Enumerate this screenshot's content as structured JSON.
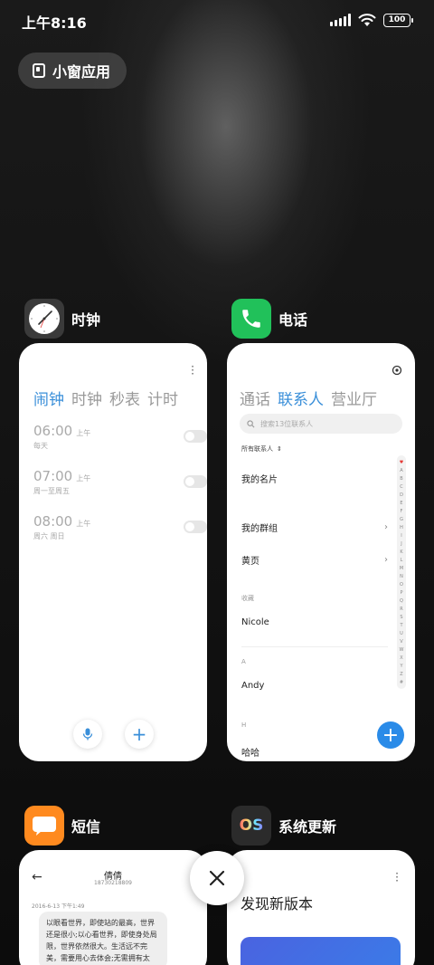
{
  "status": {
    "time": "上午8:16",
    "battery": "100"
  },
  "small_window": {
    "label": "小窗应用"
  },
  "apps": {
    "clock": {
      "name": "时钟",
      "tabs": [
        "闹钟",
        "时钟",
        "秒表",
        "计时"
      ],
      "alarms": [
        {
          "time": "06:00",
          "period": "上午",
          "repeat": "每天"
        },
        {
          "time": "07:00",
          "period": "上午",
          "repeat": "周一至周五"
        },
        {
          "time": "08:00",
          "period": "上午",
          "repeat": "周六 周日"
        }
      ]
    },
    "phone": {
      "name": "电话",
      "tabs": [
        "通话",
        "联系人",
        "营业厅"
      ],
      "search_placeholder": "搜索13位联系人",
      "all_contacts": "所有联系人",
      "my_card": "我的名片",
      "my_groups": "我的群组",
      "yellow_pages": "黄页",
      "favorites_label": "收藏",
      "favorite_contact": "Nicole",
      "section_a": "A",
      "contact_a": "Andy",
      "section_h": "H",
      "contact_h": "哈哈",
      "alphabet": [
        "♥",
        "A",
        "B",
        "C",
        "D",
        "E",
        "F",
        "G",
        "H",
        "I",
        "J",
        "K",
        "L",
        "M",
        "N",
        "O",
        "P",
        "Q",
        "R",
        "S",
        "T",
        "U",
        "V",
        "W",
        "X",
        "Y",
        "Z",
        "#"
      ]
    },
    "sms": {
      "name": "短信",
      "contact_name": "倩倩",
      "contact_number": "18730218809",
      "date": "2016-6-13 下午1:49",
      "message": "以眼看世界，即使站的最高，世界还是很小;以心看世界，即使身处局限，世界依然很大。生活远不完美，需要用心去体会;无需拥有太"
    },
    "update": {
      "name": "系统更新",
      "icon_text": "OS",
      "headline": "发现新版本"
    }
  },
  "colors": {
    "accent": "#3a8fd9",
    "clock_tab_active": "#3a8fd9",
    "phone_green": "#21c15a",
    "sms_orange": "#ff8a1f"
  }
}
